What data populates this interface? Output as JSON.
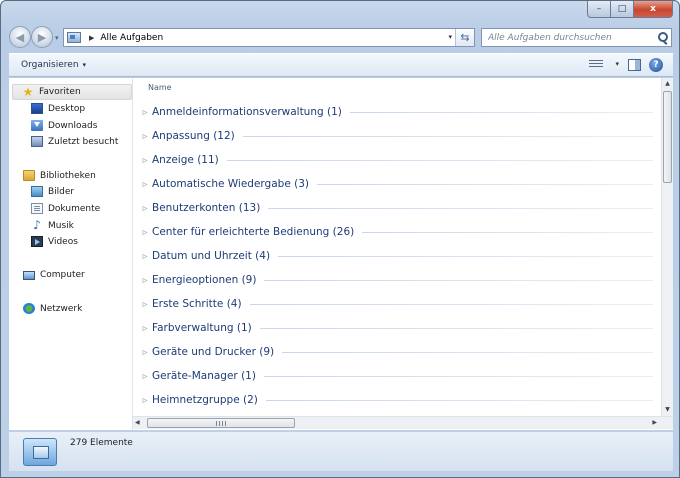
{
  "window": {
    "min_glyph": "–",
    "max_glyph": "□",
    "close_glyph": "x"
  },
  "navigation": {
    "back_glyph": "◀",
    "forward_glyph": "▶",
    "history_dropdown_glyph": "▾"
  },
  "address_bar": {
    "breadcrumb_separator": "▶",
    "breadcrumb": "Alle Aufgaben",
    "dropdown_glyph": "▾",
    "refresh_glyph": "⇆"
  },
  "search": {
    "placeholder": "Alle Aufgaben durchsuchen"
  },
  "toolbar": {
    "organize_label": "Organisieren",
    "organize_caret": "▾",
    "view_dropdown_glyph": "▾",
    "help_glyph": "?"
  },
  "nav_pane": {
    "favorites": {
      "label": "Favoriten",
      "icon_glyph": "★",
      "items": [
        {
          "label": "Desktop",
          "icon": "desktop-icon"
        },
        {
          "label": "Downloads",
          "icon": "downloads-icon"
        },
        {
          "label": "Zuletzt besucht",
          "icon": "recent-places-icon"
        }
      ]
    },
    "libraries": {
      "label": "Bibliotheken",
      "items": [
        {
          "label": "Bilder",
          "icon": "pictures-icon"
        },
        {
          "label": "Dokumente",
          "icon": "documents-icon"
        },
        {
          "label": "Musik",
          "icon": "music-icon",
          "icon_glyph": "♪"
        },
        {
          "label": "Videos",
          "icon": "videos-icon"
        }
      ]
    },
    "computer": {
      "label": "Computer"
    },
    "network": {
      "label": "Netzwerk"
    }
  },
  "list": {
    "column_header": "Name",
    "sort_glyph": "˄",
    "expand_glyph": "▷",
    "groups": [
      "Anmeldeinformationsverwaltung (1)",
      "Anpassung (12)",
      "Anzeige (11)",
      "Automatische Wiedergabe (3)",
      "Benutzerkonten (13)",
      "Center für erleichterte Bedienung (26)",
      "Datum und Uhrzeit (4)",
      "Energieoptionen (9)",
      "Erste Schritte (4)",
      "Farbverwaltung (1)",
      "Geräte und Drucker (9)",
      "Geräte-Manager (1)",
      "Heimnetzgruppe (2)"
    ]
  },
  "scrollbars": {
    "up_glyph": "▲",
    "down_glyph": "▼",
    "left_glyph": "◀",
    "right_glyph": "▶"
  },
  "status_bar": {
    "item_count": "279 Elemente"
  }
}
